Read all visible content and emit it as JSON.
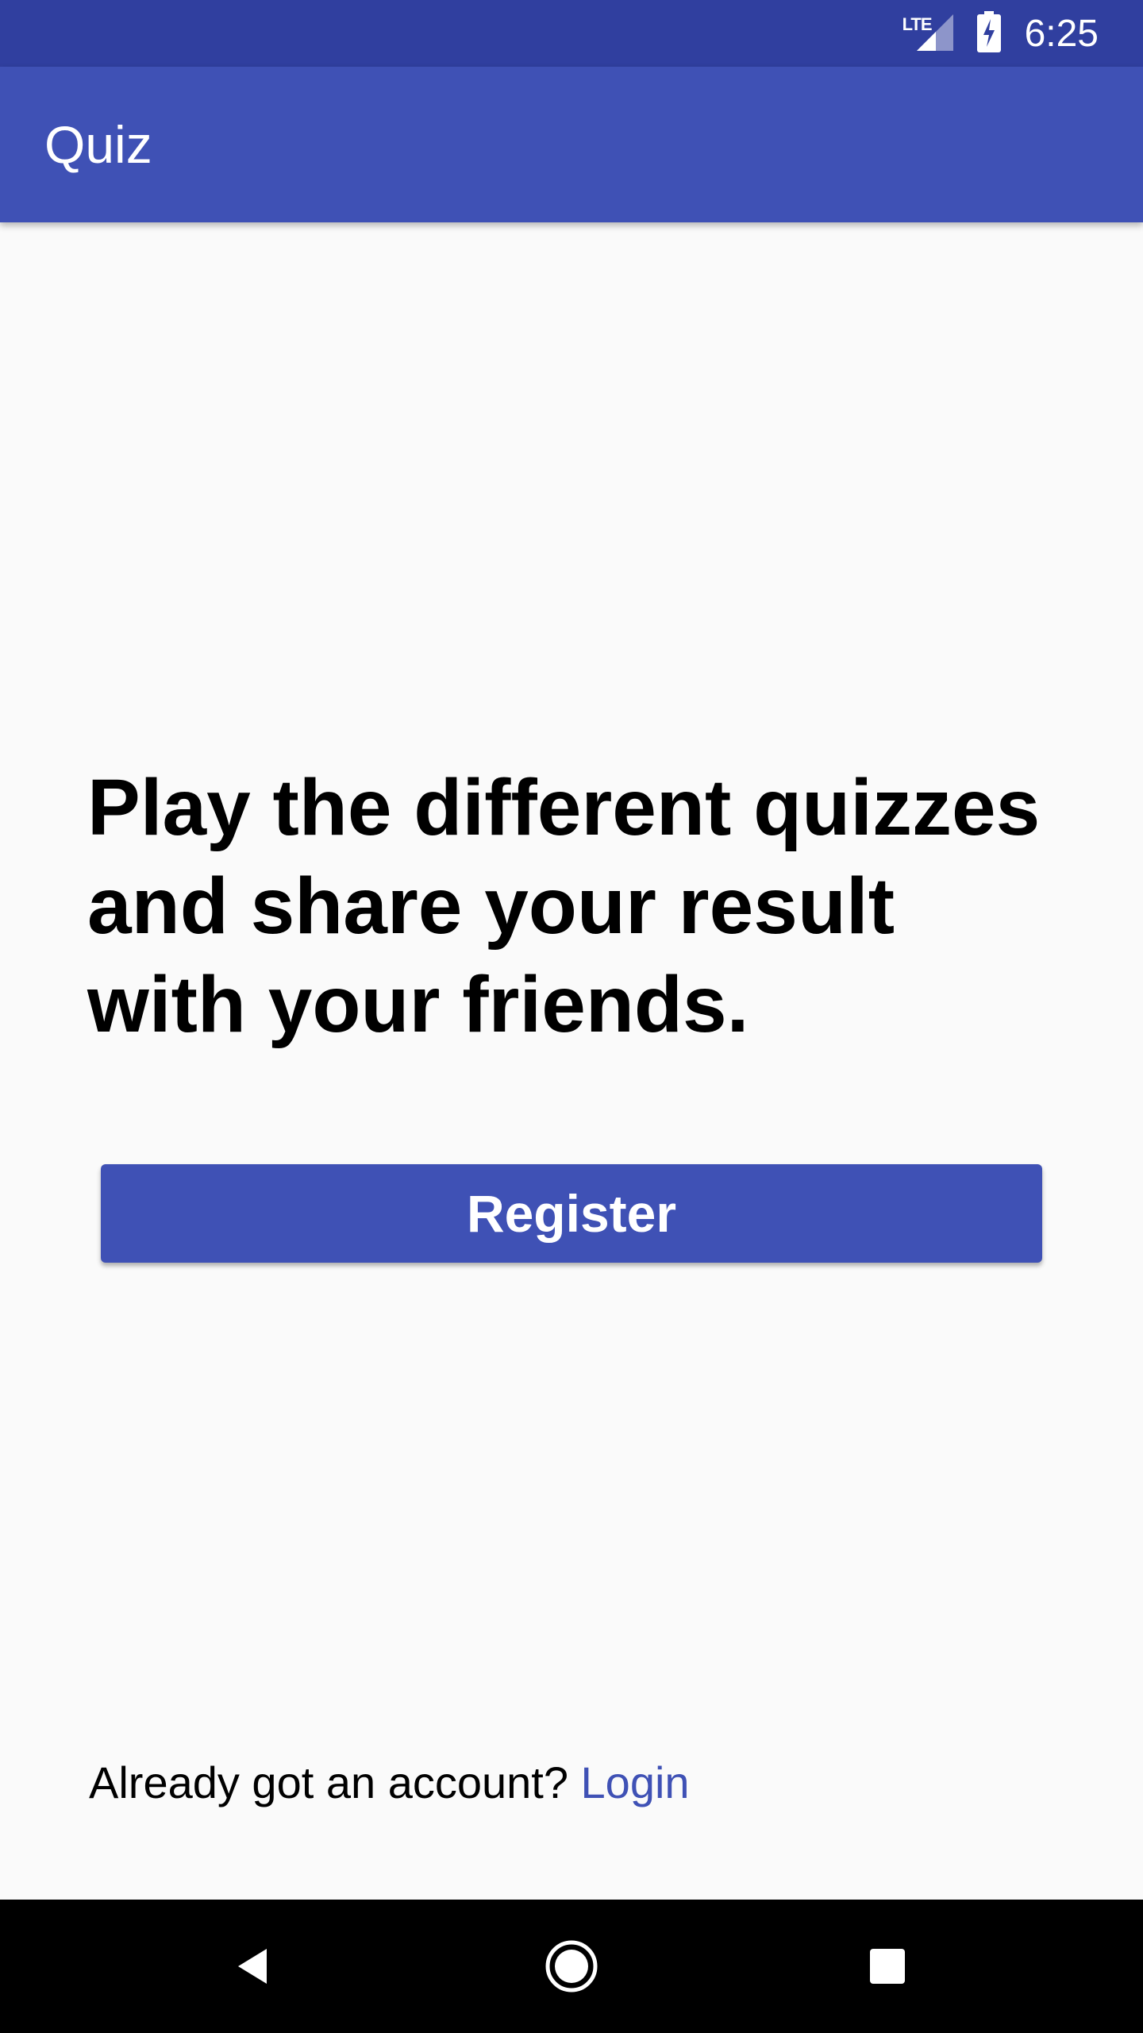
{
  "status_bar": {
    "network": "LTE",
    "time": "6:25",
    "icons": [
      "lte-signal-icon",
      "battery-charging-icon"
    ]
  },
  "app_bar": {
    "title": "Quiz"
  },
  "main": {
    "headline_line1": "Play the different quizzes",
    "headline_line2": "and share your result",
    "headline_line3": "with your friends.",
    "register_label": "Register",
    "account_prompt": "Already got an account?",
    "login_label": "Login"
  },
  "nav_bar": {
    "icons": [
      "back-icon",
      "home-icon",
      "recents-icon"
    ]
  },
  "colors": {
    "status_bar": "#303f9f",
    "primary": "#3f51b5",
    "background": "#fafafa",
    "text": "#000000"
  }
}
